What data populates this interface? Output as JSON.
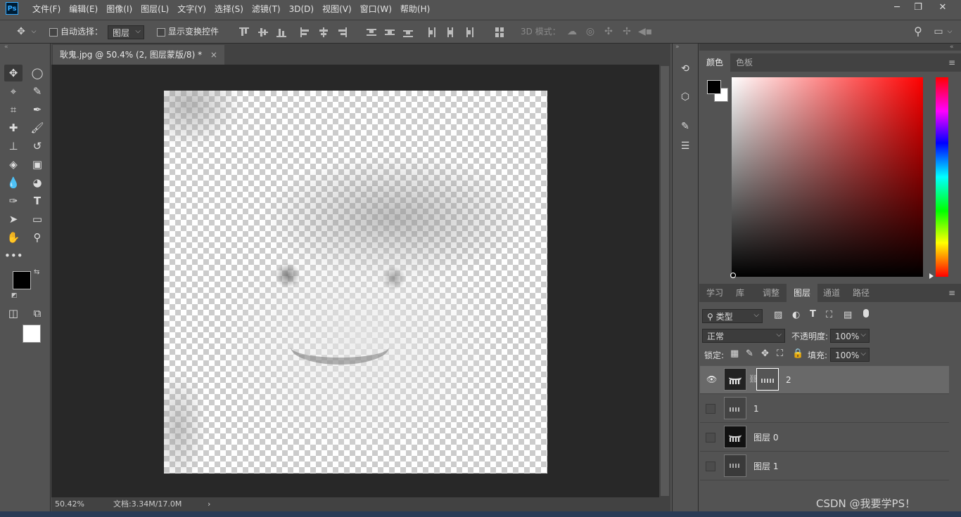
{
  "menubar": {
    "logo": "Ps",
    "items": [
      "文件(F)",
      "编辑(E)",
      "图像(I)",
      "图层(L)",
      "文字(Y)",
      "选择(S)",
      "滤镜(T)",
      "3D(D)",
      "视图(V)",
      "窗口(W)",
      "帮助(H)"
    ]
  },
  "options": {
    "auto_select_label": "自动选择：",
    "auto_select_value": "图层",
    "show_transform_label": "显示变换控件",
    "mode_3d_label": "3D 模式："
  },
  "document": {
    "tab_title": "耿鬼.jpg @ 50.4% (2, 图层蒙版/8) *",
    "close": "×"
  },
  "status": {
    "zoom": "50.42%",
    "doc_size": "文档:3.34M/17.0M",
    "arrow": "›"
  },
  "color_panel": {
    "tabs": [
      "颜色",
      "色板"
    ]
  },
  "layers_panel": {
    "tabs": [
      "学习",
      "库",
      "调整",
      "图层",
      "通道",
      "路径"
    ],
    "filter_kind": "类型",
    "blend_mode": "正常",
    "opacity_label": "不透明度:",
    "opacity_value": "100%",
    "lock_label": "锁定:",
    "fill_label": "填充:",
    "fill_value": "100%",
    "layers": [
      {
        "name": "2",
        "visible": true,
        "selected": true,
        "has_mask": true
      },
      {
        "name": "1",
        "visible": false,
        "selected": false,
        "has_mask": false
      },
      {
        "name": "图层 0",
        "visible": false,
        "selected": false,
        "has_mask": false
      },
      {
        "name": "图层 1",
        "visible": false,
        "selected": false,
        "has_mask": false
      }
    ]
  },
  "watermark": "CSDN @我要学PS！",
  "colors": {
    "fg": "#000000",
    "bg": "#ffffff",
    "accent": "#31a8ff"
  }
}
